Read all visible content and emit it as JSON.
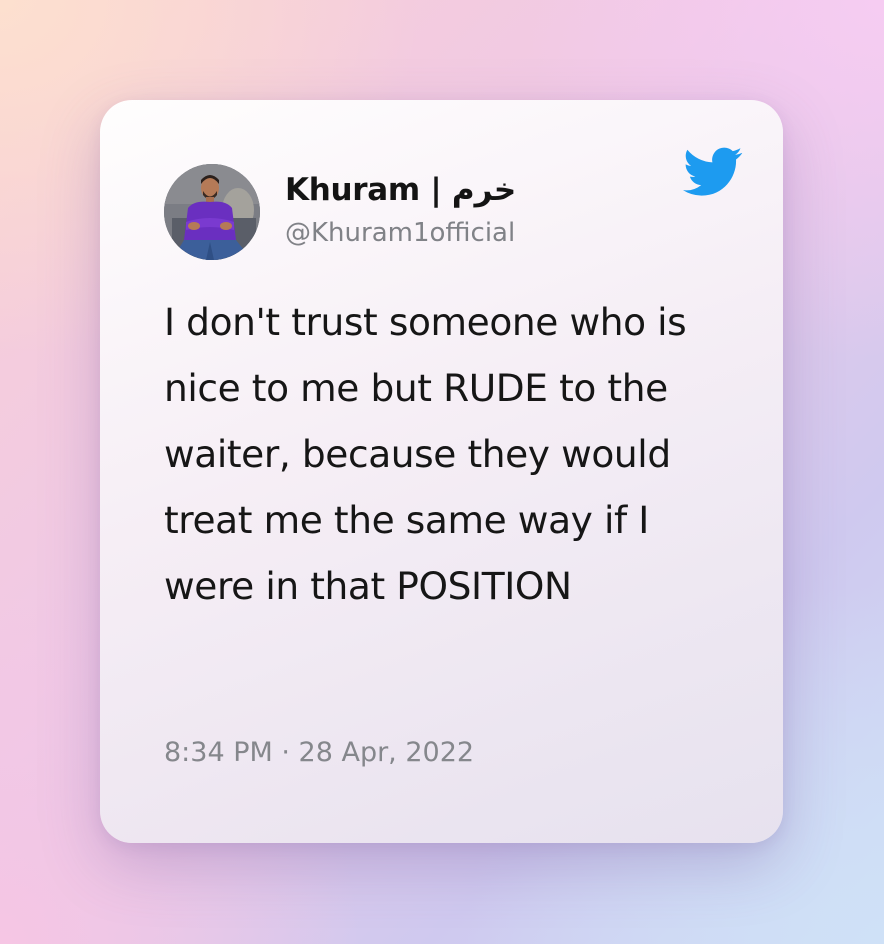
{
  "author": {
    "display_name": "Khuram | خرم",
    "handle": "@Khuram1official",
    "avatar_icon": "profile-photo"
  },
  "tweet": {
    "text": "I don't trust someone who is nice to me but RUDE to the waiter, because they would treat me the same way if I were in that POSITION",
    "timestamp": "8:34 PM · 28 Apr, 2022"
  },
  "brand": {
    "icon": "twitter-bird-icon",
    "color": "#1d9bf0"
  }
}
